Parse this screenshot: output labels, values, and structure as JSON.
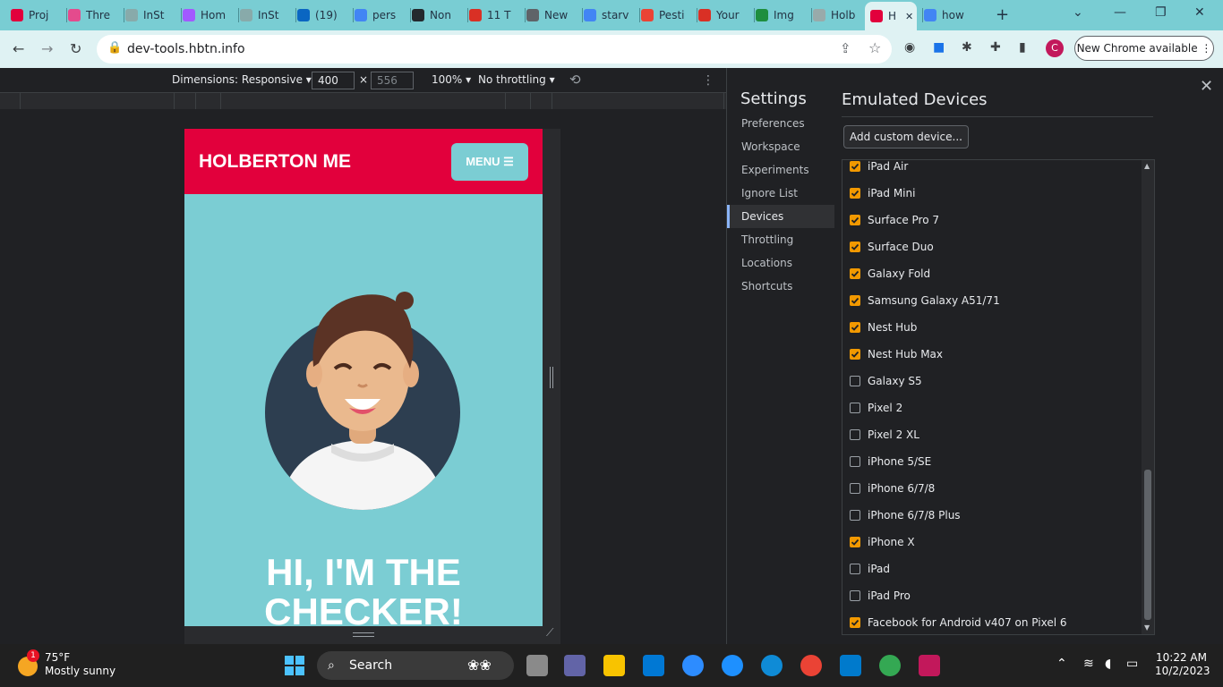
{
  "browser": {
    "tabs": [
      {
        "label": "Proj",
        "color": "#e2003c"
      },
      {
        "label": "Thre",
        "color": "#e44b8d"
      },
      {
        "label": "InSt",
        "color": "#8aa"
      },
      {
        "label": "Hom",
        "color": "#a259ff"
      },
      {
        "label": "InSt",
        "color": "#8aa"
      },
      {
        "label": "(19)",
        "color": "#0a66c2"
      },
      {
        "label": "pers",
        "color": "#4285f4"
      },
      {
        "label": "Non",
        "color": "#24292e"
      },
      {
        "label": "11 T",
        "color": "#d93025"
      },
      {
        "label": "New",
        "color": "#5f6368"
      },
      {
        "label": "starv",
        "color": "#4285f4"
      },
      {
        "label": "Pesti",
        "color": "#ea4335"
      },
      {
        "label": "Your",
        "color": "#d93025"
      },
      {
        "label": "Img",
        "color": "#1e8e3e"
      },
      {
        "label": "Holb",
        "color": "#9aa"
      },
      {
        "label": "H",
        "color": "#e2003c"
      },
      {
        "label": "how",
        "color": "#4285f4"
      }
    ],
    "new_tab": "+",
    "url": "dev-tools.hbtn.info",
    "new_chrome": "New Chrome available",
    "avatar_letter": "C"
  },
  "devtools": {
    "dimensions": "Dimensions: Responsive ▾",
    "width": "400",
    "times": "×",
    "height": "556",
    "zoom": "100% ▾",
    "throttling": "No throttling ▾"
  },
  "page": {
    "brand": "HOLBERTON ME",
    "menu": "MENU ☰",
    "hero_line1": "HI, I'M THE",
    "hero_line2": "CHECKER!"
  },
  "settings": {
    "title": "Settings",
    "nav": [
      "Preferences",
      "Workspace",
      "Experiments",
      "Ignore List",
      "Devices",
      "Throttling",
      "Locations",
      "Shortcuts"
    ],
    "selected": "Devices",
    "section_title": "Emulated Devices",
    "add_button": "Add custom device...",
    "devices": [
      {
        "name": "iPad Air",
        "checked": true
      },
      {
        "name": "iPad Mini",
        "checked": true
      },
      {
        "name": "Surface Pro 7",
        "checked": true
      },
      {
        "name": "Surface Duo",
        "checked": true
      },
      {
        "name": "Galaxy Fold",
        "checked": true
      },
      {
        "name": "Samsung Galaxy A51/71",
        "checked": true
      },
      {
        "name": "Nest Hub",
        "checked": true
      },
      {
        "name": "Nest Hub Max",
        "checked": true
      },
      {
        "name": "Galaxy S5",
        "checked": false
      },
      {
        "name": "Pixel 2",
        "checked": false
      },
      {
        "name": "Pixel 2 XL",
        "checked": false
      },
      {
        "name": "iPhone 5/SE",
        "checked": false
      },
      {
        "name": "iPhone 6/7/8",
        "checked": false
      },
      {
        "name": "iPhone 6/7/8 Plus",
        "checked": false
      },
      {
        "name": "iPhone X",
        "checked": true
      },
      {
        "name": "iPad",
        "checked": false
      },
      {
        "name": "iPad Pro",
        "checked": false
      },
      {
        "name": "Facebook for Android v407 on Pixel 6",
        "checked": true
      }
    ]
  },
  "taskbar": {
    "weather_temp": "75°F",
    "weather_desc": "Mostly sunny",
    "weather_badge": "1",
    "search": "Search",
    "time": "10:22 AM",
    "date": "10/2/2023"
  },
  "colors": {
    "accent": "#e2003c",
    "teal": "#7bcdd3",
    "checkbox": "#f29900"
  }
}
